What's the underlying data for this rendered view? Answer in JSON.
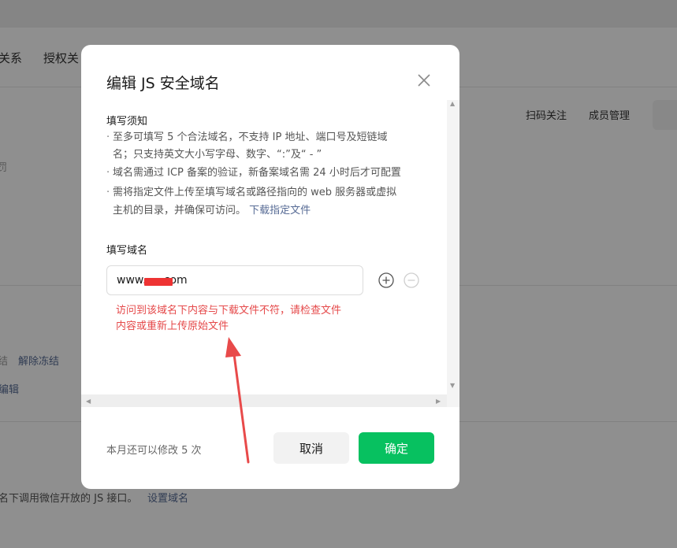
{
  "background": {
    "tabs": [
      "关系",
      "授权关"
    ],
    "actions": [
      "扫码关注",
      "成员管理"
    ],
    "left_fragments": [
      "罚",
      "结",
      "编辑"
    ],
    "unfreeze_link": "解除冻结",
    "bottom_text": "名下调用微信开放的 JS 接口。",
    "bottom_link": "设置域名"
  },
  "modal": {
    "title": "编辑 JS 安全域名",
    "notice_title": "填写须知",
    "notes": [
      "至多可填写 5 个合法域名，不支持 IP 地址、端口号及短链域",
      "名；只支持英文大小写字母、数字、“:”及“ - ”",
      "域名需通过 ICP 备案的验证，新备案域名需 24 小时后才可配置",
      "需将指定文件上传至填写域名或路径指向的 web 服务器或虚拟",
      "主机的目录，并确保可访问。"
    ],
    "download_link": "下载指定文件",
    "domain_label": "填写域名",
    "domain_value": "www.    .com",
    "error_lines": [
      "访问到该域名下内容与下载文件不符，请检查文件",
      "内容或重新上传原始文件"
    ],
    "footer_note": "本月还可以修改 5 次",
    "cancel_label": "取消",
    "confirm_label": "确定"
  },
  "colors": {
    "accent_green": "#07c160",
    "link_blue": "#576b95",
    "error_red": "#e5494a",
    "annotation_red": "#e84a4a"
  },
  "icons": {
    "close": "close-icon",
    "add": "plus-circle-icon",
    "remove": "minus-circle-icon"
  }
}
